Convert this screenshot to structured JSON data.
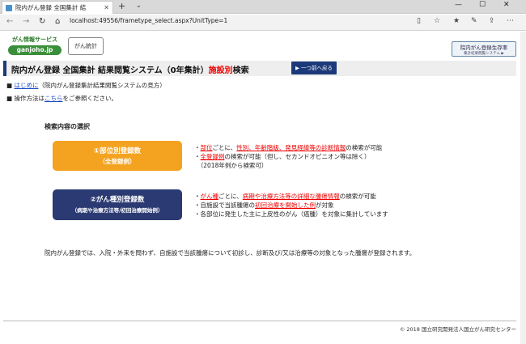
{
  "browser": {
    "tab_title": "院内がん登録 全国集計 結",
    "new_tab": "+",
    "tab_chevron": "⌄",
    "address": "localhost:49556/frametype_select.aspx?UnitType=1",
    "window_controls": [
      "—",
      "☐",
      "✕"
    ]
  },
  "header": {
    "logo_top": "がん情報サービス",
    "logo_bottom": "ganjoho.jp",
    "toukei": "がん統計",
    "seizon_a": "院内がん登録生存率",
    "seizon_b": "集計結果閲覧システム ▶"
  },
  "title": {
    "main": "院内がん登録 全国集計 結果閲覧システム（0年集計）",
    "red": "施設別",
    "suffix": "検索",
    "back_button": "▶ 一つ前へ戻る"
  },
  "intro": {
    "line1_prefix": "■ ",
    "line1_link": "はじめに",
    "line1_suffix": "（院内がん登録集計結果閲覧システムの見方）",
    "line2_prefix": "■ 操作方法は",
    "line2_link": "こちら",
    "line2_suffix": "をご参照ください。"
  },
  "section": {
    "heading": "検索内容の選択",
    "button1_l1": "①部位別登録数",
    "button1_l2": "（全登録例）",
    "button2_l1": "②がん種別登録数",
    "button2_l2": "（病期や治療方法等/初回治療開始例）",
    "desc1": [
      {
        "a": "・",
        "b": "部位",
        "c": "ごとに、",
        "d": "性別、年齢階級、発見経緯等の診断情報",
        "e": "の検索が可能"
      },
      {
        "a": "・",
        "b": "全登録例",
        "c": "の検索が可能（但し、セカンドオピニオン等は除く）",
        "d": "",
        "e": ""
      },
      {
        "a": "　（2018年例から検索可）",
        "b": "",
        "c": "",
        "d": "",
        "e": ""
      }
    ],
    "desc2": [
      {
        "a": "・",
        "b": "がん種",
        "c": "ごとに、",
        "d": "病期や治療方法等の詳細な腫瘍情報",
        "e": "の検索が可能"
      },
      {
        "a": "・自施設で当該腫瘍の",
        "b": "",
        "c": "",
        "d": "初回治療を開始した例",
        "e": "が対象"
      },
      {
        "a": "・各部位に発生した主に上皮性のがん（癌腫）を対象に集計しています",
        "b": "",
        "c": "",
        "d": "",
        "e": ""
      }
    ]
  },
  "footer": {
    "text": "院内がん登録では、入院・外来を問わず、自施設で当該腫瘍について初診し、診断及び/又は治療等の対象となった腫瘍が登録されます。",
    "copyright": "© 2018 国立研究開発法人国立がん研究センター"
  }
}
